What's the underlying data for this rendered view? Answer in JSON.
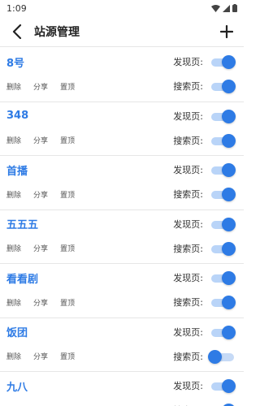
{
  "status_bar": {
    "time": "1:09",
    "icons": [
      "wifi-icon",
      "signal-icon",
      "battery-icon"
    ]
  },
  "header": {
    "title": "站源管理",
    "back_icon": "back-arrow-icon",
    "add_icon": "plus-icon"
  },
  "labels": {
    "discover": "发现页:",
    "search": "搜索页:",
    "delete": "删除",
    "share": "分享",
    "pin": "置顶"
  },
  "colors": {
    "accent": "#2e7be5",
    "track": "#b9d4f8"
  },
  "sources": [
    {
      "name": "8号",
      "discover_on": true,
      "search_on": true
    },
    {
      "name": "348",
      "discover_on": true,
      "search_on": true
    },
    {
      "name": "首播",
      "discover_on": true,
      "search_on": true
    },
    {
      "name": "五五五",
      "discover_on": true,
      "search_on": true
    },
    {
      "name": "看看剧",
      "discover_on": true,
      "search_on": true
    },
    {
      "name": "饭团",
      "discover_on": true,
      "search_on": false
    },
    {
      "name": "九八",
      "discover_on": true,
      "search_on": true
    }
  ]
}
